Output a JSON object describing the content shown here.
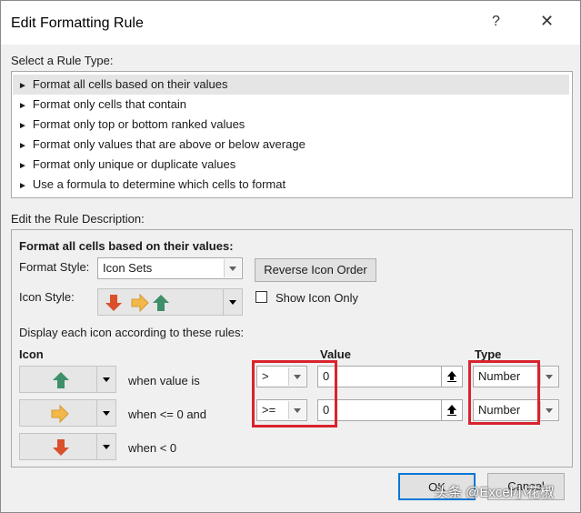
{
  "dialog": {
    "title": "Edit Formatting Rule",
    "help_label": "?",
    "close_label": "✕"
  },
  "rule_type": {
    "heading": "Select a Rule Type:",
    "items": [
      {
        "label": "Format all cells based on their values",
        "selected": true
      },
      {
        "label": "Format only cells that contain"
      },
      {
        "label": "Format only top or bottom ranked values"
      },
      {
        "label": "Format only values that are above or below average"
      },
      {
        "label": "Format only unique or duplicate values"
      },
      {
        "label": "Use a formula to determine which cells to format"
      }
    ],
    "bullet": "►"
  },
  "description": {
    "heading": "Edit the Rule Description:",
    "subheading": "Format all cells based on their values:",
    "format_style_label": "Format Style:",
    "format_style_value": "Icon Sets",
    "reverse_button": "Reverse Icon Order",
    "icon_style_label": "Icon Style:",
    "show_icon_only_label": "Show Icon Only",
    "show_icon_only_checked": false,
    "display_rules_label": "Display each icon according to these rules:",
    "col_icon": "Icon",
    "col_value": "Value",
    "col_type": "Type",
    "rows": [
      {
        "icon": "green-up-arrow-icon",
        "condition": "when value is",
        "operator": ">",
        "value": "0",
        "type": "Number"
      },
      {
        "icon": "yellow-right-arrow-icon",
        "condition": "when <= 0 and",
        "operator": ">=",
        "value": "0",
        "type": "Number"
      },
      {
        "icon": "red-down-arrow-icon",
        "condition": "when < 0"
      }
    ]
  },
  "buttons": {
    "ok": "OK",
    "cancel": "Cancel"
  },
  "watermark": "头条 @Excel小花椒",
  "colors": {
    "green_arrow": "#3e8f6a",
    "yellow_arrow": "#f2b84a",
    "red_arrow": "#d9502a",
    "highlight": "#d9232e"
  }
}
